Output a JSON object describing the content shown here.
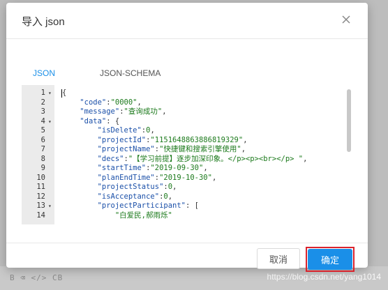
{
  "dialog": {
    "title": "导入 json",
    "close_icon": "close-icon"
  },
  "tabs": [
    {
      "label": "JSON",
      "active": true
    },
    {
      "label": "JSON-SCHEMA",
      "active": false
    }
  ],
  "editor": {
    "line_numbers": [
      "1",
      "2",
      "3",
      "4",
      "5",
      "6",
      "7",
      "8",
      "9",
      "10",
      "11",
      "12",
      "13",
      "14"
    ],
    "fold_markers": {
      "1": "▾",
      "4": "▾",
      "13": "▾"
    },
    "lines": [
      [
        {
          "t": "{",
          "c": "p"
        }
      ],
      [
        {
          "t": "    ",
          "c": "p"
        },
        {
          "t": "\"code\"",
          "c": "k"
        },
        {
          "t": ":",
          "c": "p"
        },
        {
          "t": "\"0000\"",
          "c": "s"
        },
        {
          "t": ",",
          "c": "p"
        }
      ],
      [
        {
          "t": "    ",
          "c": "p"
        },
        {
          "t": "\"message\"",
          "c": "k"
        },
        {
          "t": ":",
          "c": "p"
        },
        {
          "t": "\"查询成功\"",
          "c": "s"
        },
        {
          "t": ",",
          "c": "p"
        }
      ],
      [
        {
          "t": "    ",
          "c": "p"
        },
        {
          "t": "\"data\"",
          "c": "k"
        },
        {
          "t": ": {",
          "c": "p"
        }
      ],
      [
        {
          "t": "        ",
          "c": "p"
        },
        {
          "t": "\"isDelete\"",
          "c": "k"
        },
        {
          "t": ":",
          "c": "p"
        },
        {
          "t": "0",
          "c": "n"
        },
        {
          "t": ",",
          "c": "p"
        }
      ],
      [
        {
          "t": "        ",
          "c": "p"
        },
        {
          "t": "\"projectId\"",
          "c": "k"
        },
        {
          "t": ":",
          "c": "p"
        },
        {
          "t": "\"1151648863886819329\"",
          "c": "s"
        },
        {
          "t": ",",
          "c": "p"
        }
      ],
      [
        {
          "t": "        ",
          "c": "p"
        },
        {
          "t": "\"projectName\"",
          "c": "k"
        },
        {
          "t": ":",
          "c": "p"
        },
        {
          "t": "\"快捷键和搜索引擎使用\"",
          "c": "s"
        },
        {
          "t": ",",
          "c": "p"
        }
      ],
      [
        {
          "t": "        ",
          "c": "p"
        },
        {
          "t": "\"decs\"",
          "c": "k"
        },
        {
          "t": ":",
          "c": "p"
        },
        {
          "t": "\"【学习前提】逐步加深印象。</p><p><br></p> \"",
          "c": "s"
        },
        {
          "t": ",",
          "c": "p"
        }
      ],
      [
        {
          "t": "        ",
          "c": "p"
        },
        {
          "t": "\"startTime\"",
          "c": "k"
        },
        {
          "t": ":",
          "c": "p"
        },
        {
          "t": "\"2019-09-30\"",
          "c": "s"
        },
        {
          "t": ",",
          "c": "p"
        }
      ],
      [
        {
          "t": "        ",
          "c": "p"
        },
        {
          "t": "\"planEndTime\"",
          "c": "k"
        },
        {
          "t": ":",
          "c": "p"
        },
        {
          "t": "\"2019-10-30\"",
          "c": "s"
        },
        {
          "t": ",",
          "c": "p"
        }
      ],
      [
        {
          "t": "        ",
          "c": "p"
        },
        {
          "t": "\"projectStatus\"",
          "c": "k"
        },
        {
          "t": ":",
          "c": "p"
        },
        {
          "t": "0",
          "c": "n"
        },
        {
          "t": ",",
          "c": "p"
        }
      ],
      [
        {
          "t": "        ",
          "c": "p"
        },
        {
          "t": "\"isAcceptance\"",
          "c": "k"
        },
        {
          "t": ":",
          "c": "p"
        },
        {
          "t": "0",
          "c": "n"
        },
        {
          "t": ",",
          "c": "p"
        }
      ],
      [
        {
          "t": "        ",
          "c": "p"
        },
        {
          "t": "\"projectParticipant\"",
          "c": "k"
        },
        {
          "t": ": [",
          "c": "p"
        }
      ],
      [
        {
          "t": "            ",
          "c": "p"
        },
        {
          "t": "\"白爱民,郝雨烁\"",
          "c": "s"
        }
      ]
    ]
  },
  "footer": {
    "cancel_label": "取消",
    "ok_label": "确定"
  },
  "background": {
    "toolbar_text": "B  ⌫  </>  CB",
    "watermark": "https://blog.csdn.net/yang1014"
  },
  "colors": {
    "accent": "#1a8fe8",
    "highlight_outline": "#d9232d"
  }
}
